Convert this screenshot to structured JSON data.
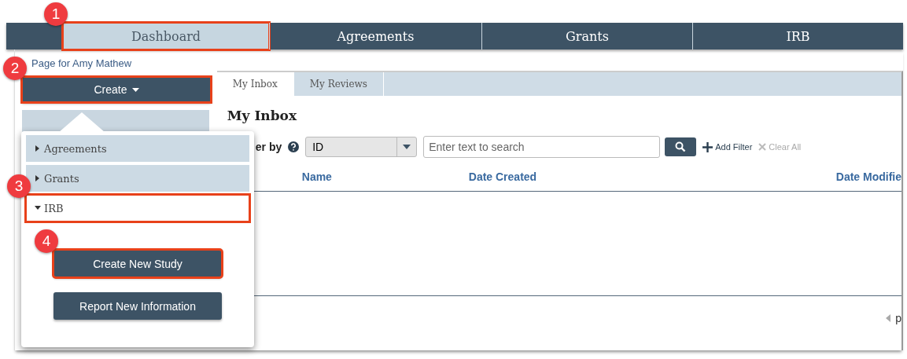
{
  "nav": {
    "tabs": [
      {
        "label": "Dashboard",
        "selected": true,
        "highlighted": true,
        "callout": "1"
      },
      {
        "label": "Agreements",
        "selected": false,
        "highlighted": false
      },
      {
        "label": "Grants",
        "selected": false,
        "highlighted": false
      },
      {
        "label": "IRB",
        "selected": false,
        "highlighted": false
      }
    ]
  },
  "sidebar": {
    "owner_link": "Page for Amy Mathew",
    "create_button": {
      "label": "Create",
      "highlighted": true,
      "callout": "2"
    }
  },
  "create_menu": {
    "categories": [
      {
        "label": "Agreements",
        "expanded": false,
        "highlighted": false
      },
      {
        "label": "Grants",
        "expanded": false,
        "highlighted": false
      },
      {
        "label": "IRB",
        "expanded": true,
        "highlighted": true,
        "callout": "3"
      }
    ],
    "actions": [
      {
        "label": "Create New Study",
        "highlighted": true,
        "callout": "4"
      },
      {
        "label": "Report New Information",
        "highlighted": false
      }
    ]
  },
  "inbox": {
    "tabs": [
      {
        "label": "My Inbox",
        "selected": true
      },
      {
        "label": "My Reviews",
        "selected": false
      }
    ],
    "heading": "My Inbox",
    "filter": {
      "label": "er by",
      "field": "ID",
      "search_placeholder": "Enter text to search",
      "add_filter": "Add Filter",
      "clear_all": {
        "label": "Clear All",
        "disabled": true
      }
    },
    "columns": [
      "Name",
      "Date Created",
      "Date Modifie"
    ],
    "pager": "p"
  }
}
